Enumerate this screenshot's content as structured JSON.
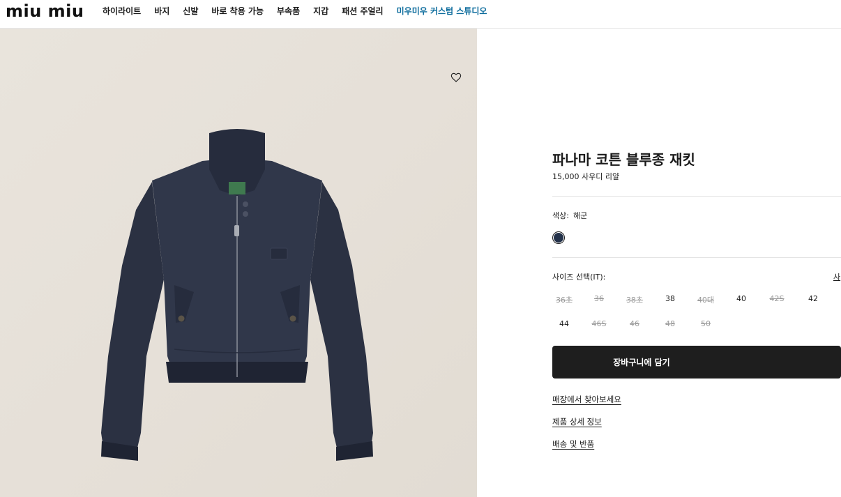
{
  "brand": {
    "logo_text": "miu miu"
  },
  "nav": {
    "items": [
      {
        "label": "하이라이트"
      },
      {
        "label": "바지"
      },
      {
        "label": "신발"
      },
      {
        "label": "바로 착용 가능"
      },
      {
        "label": "부속품"
      },
      {
        "label": "지갑"
      },
      {
        "label": "패션 주얼리"
      },
      {
        "label": "미우미우 커스텀 스튜디오"
      }
    ]
  },
  "gallery": {
    "wishlist_icon": "heart-outline-icon"
  },
  "product": {
    "title": "파나마 코튼 블루종 재킷",
    "price": "15,000 사우디 리얄",
    "color_label": "색상:",
    "color_value": "해군",
    "swatch_color": "#24324a",
    "size_label": "사이즈 선택(IT):",
    "size_guide": "사",
    "sizes": [
      {
        "label": "36초",
        "available": false
      },
      {
        "label": "36",
        "available": false
      },
      {
        "label": "38초",
        "available": false
      },
      {
        "label": "38",
        "available": true
      },
      {
        "label": "40대",
        "available": false
      },
      {
        "label": "40",
        "available": true
      },
      {
        "label": "42S",
        "available": false
      },
      {
        "label": "42",
        "available": true
      },
      {
        "label": "44",
        "available": true
      },
      {
        "label": "46S",
        "available": false
      },
      {
        "label": "46",
        "available": false
      },
      {
        "label": "48",
        "available": false
      },
      {
        "label": "50",
        "available": false
      }
    ],
    "add_to_cart": "장바구니에 담기",
    "links": {
      "find_in_store": "매장에서 찾아보세요",
      "details": "제품 상세 정보",
      "shipping": "배송 및 반품"
    }
  },
  "colors": {
    "accent_nav": "#0b6b9c",
    "button_bg": "#1e1e1e"
  }
}
